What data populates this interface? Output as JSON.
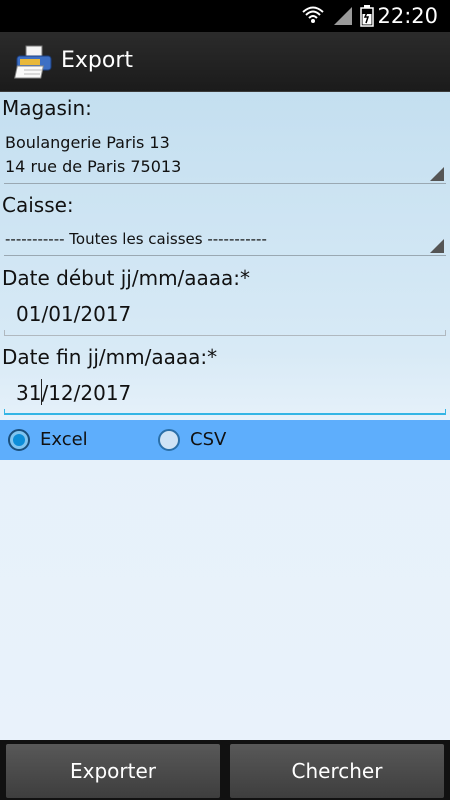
{
  "status_bar": {
    "time": "22:20",
    "icons": [
      "wifi-icon",
      "signal-icon",
      "battery-icon"
    ]
  },
  "action_bar": {
    "title": "Export",
    "app_icon": "printer-app-icon"
  },
  "form": {
    "magasin": {
      "label": "Magasin:",
      "line1": "Boulangerie Paris 13",
      "line2": "14 rue de Paris 75013"
    },
    "caisse": {
      "label": "Caisse:",
      "value": "----------- Toutes les caisses -----------"
    },
    "date_debut": {
      "label": "Date début jj/mm/aaaa:*",
      "value": "01/01/2017"
    },
    "date_fin": {
      "label": "Date fin jj/mm/aaaa:*",
      "value": "31/12/2017"
    },
    "format": {
      "options": [
        "Excel",
        "CSV"
      ],
      "selected": "Excel"
    }
  },
  "buttons": {
    "exporter": "Exporter",
    "chercher": "Chercher"
  },
  "colors": {
    "accent": "#33b5e5",
    "radio_bar": "#5eaefc",
    "content_bg": "#d8eaf6"
  }
}
